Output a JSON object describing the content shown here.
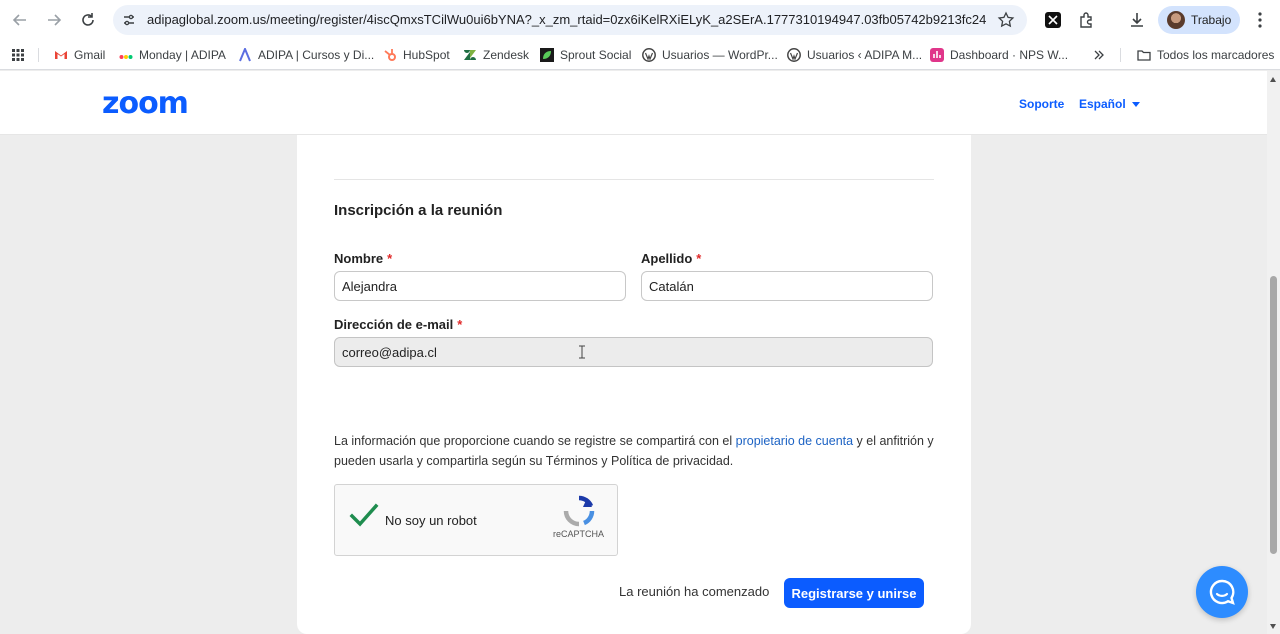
{
  "browser": {
    "url": "adipaglobal.zoom.us/meeting/register/4iscQmxsTCilWu0ui6bYNA?_x_zm_rtaid=0zx6iKelRXiELyK_a2SErA.1777310194947.03fb05742b9213fc241...",
    "profile_label": "Trabajo",
    "nav_icons": [
      "back-icon",
      "forward-icon",
      "reload-icon"
    ],
    "bookmarks": [
      {
        "label": "Gmail",
        "icon": "gmail-icon",
        "color": "#ea4335"
      },
      {
        "label": "Monday | ADIPA",
        "icon": "monday-icon",
        "color": "#ff3d57"
      },
      {
        "label": "ADIPA | Cursos y Di...",
        "icon": "adipa-icon",
        "color": "#5b6ee1"
      },
      {
        "label": "HubSpot",
        "icon": "hubspot-icon",
        "color": "#ff7a59"
      },
      {
        "label": "Zendesk",
        "icon": "zendesk-icon",
        "color": "#03363d"
      },
      {
        "label": "Sprout Social",
        "icon": "sprout-icon",
        "color": "#59cb59"
      },
      {
        "label": "Usuarios — WordPr...",
        "icon": "wordpress-icon",
        "color": "#464646"
      },
      {
        "label": "Usuarios ‹ ADIPA M...",
        "icon": "wordpress-icon",
        "color": "#464646"
      },
      {
        "label": "Dashboard · NPS W...",
        "icon": "nps-icon",
        "color": "#e0368a"
      }
    ],
    "all_bookmarks_label": "Todos los marcadores"
  },
  "header": {
    "logo": "zoom",
    "support_link": "Soporte",
    "language": "Español"
  },
  "form": {
    "section_title": "Inscripción a la reunión",
    "first_name_label": "Nombre",
    "first_name_value": "Alejandra",
    "last_name_label": "Apellido",
    "last_name_value": "Catalán",
    "email_label": "Dirección de e-mail",
    "email_value": "correo@adipa.cl",
    "required_mark": "*",
    "disclaimer_before": "La información que proporcione cuando se registre se compartirá con el ",
    "disclaimer_link": "propietario de cuenta",
    "disclaimer_after": " y el anfitrión y pueden usarla y compartirla según su Términos y Política de privacidad.",
    "captcha_label": "No soy un robot",
    "captcha_brand": "reCAPTCHA",
    "captcha_checked": true,
    "meeting_status": "La reunión ha comenzado",
    "submit_label": "Registrarse y unirse"
  },
  "colors": {
    "zoom_blue": "#0b5cff",
    "fab_blue": "#2d8cff",
    "link_blue": "#1d63c4",
    "required_red": "#e02828",
    "check_green": "#1f8d4f"
  }
}
